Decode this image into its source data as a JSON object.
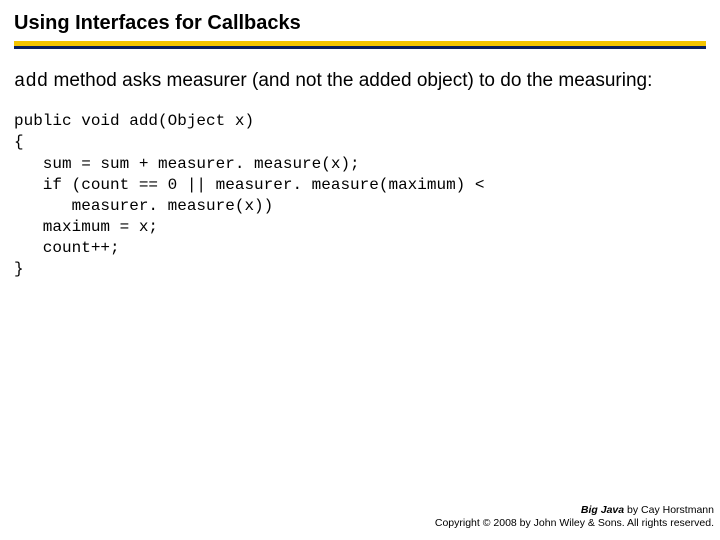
{
  "title": "Using Interfaces for Callbacks",
  "body": {
    "code_word": "add",
    "rest": " method asks measurer (and not the added object) to do the measuring:"
  },
  "code": "public void add(Object x)\n{\n   sum = sum + measurer. measure(x);\n   if (count == 0 || measurer. measure(maximum) <\n      measurer. measure(x))\n   maximum = x;\n   count++;\n}",
  "footer": {
    "book": "Big Java",
    "author_line": " by Cay Horstmann",
    "copyright": "Copyright © 2008 by John Wiley & Sons. All rights reserved."
  }
}
